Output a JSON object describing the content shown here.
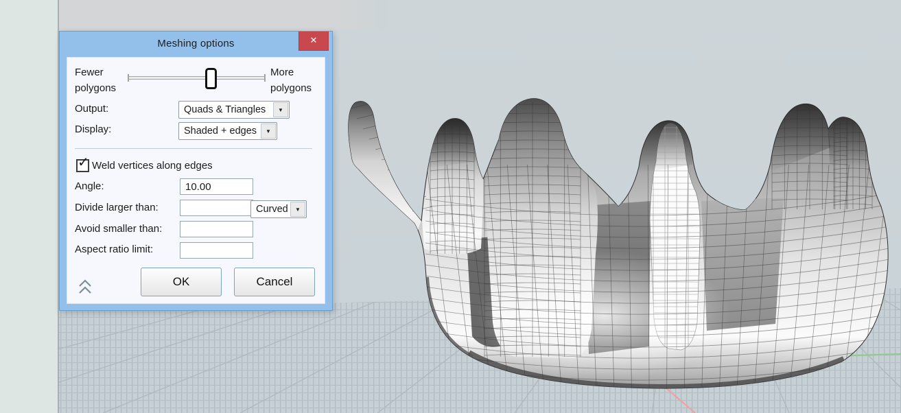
{
  "dialog": {
    "title": "Meshing options",
    "close_glyph": "✕",
    "dropdown_arrow": "▼",
    "slider": {
      "left_label": "Fewer polygons",
      "right_label": "More polygons"
    },
    "output": {
      "label": "Output:",
      "value": "Quads & Triangles"
    },
    "display": {
      "label": "Display:",
      "value": "Shaded + edges"
    },
    "weld": {
      "label": "Weld vertices along edges",
      "checked": true,
      "check_glyph": "✓"
    },
    "angle": {
      "label": "Angle:",
      "value": "10.00"
    },
    "divide": {
      "label": "Divide larger than:",
      "value": "",
      "option": "Curved"
    },
    "avoid": {
      "label": "Avoid smaller than:",
      "value": ""
    },
    "aspect": {
      "label": "Aspect ratio limit:",
      "value": ""
    },
    "ok_label": "OK",
    "cancel_label": "Cancel"
  },
  "viewport": {
    "content": "shaded mesh model of a crown-shaped ring with prongs on a perspective grid floor",
    "colors": {
      "background": "#ccd4d8",
      "floor": "#c7d0d4",
      "grid_line": "#b0bcc1",
      "axis_x_red": "#eda3a3",
      "axis_y_green": "#8fca8f",
      "dialog_frame_blue": "#93c0ea",
      "close_button_red": "#c9484e"
    }
  }
}
